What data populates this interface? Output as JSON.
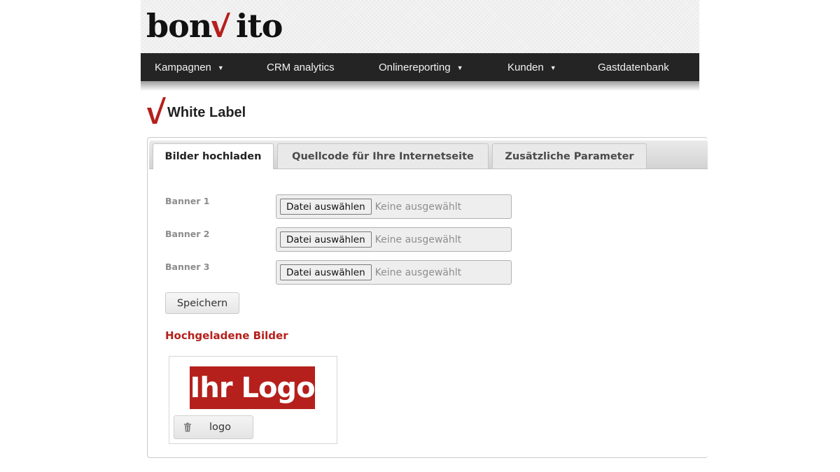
{
  "brand": {
    "logo_prefix": "bon",
    "logo_v": "V",
    "logo_suffix": "ito",
    "accent_color": "#b5201c"
  },
  "nav": {
    "items": [
      {
        "label": "Kampagnen",
        "has_dropdown": true
      },
      {
        "label": "CRM analytics",
        "has_dropdown": false
      },
      {
        "label": "Onlinereporting",
        "has_dropdown": true
      },
      {
        "label": "Kunden",
        "has_dropdown": true
      },
      {
        "label": "Gastdatenbank",
        "has_dropdown": false
      }
    ],
    "caret": "▼"
  },
  "page": {
    "title": "White Label",
    "title_icon": "checkmark-icon"
  },
  "tabs": [
    {
      "label": "Bilder hochladen",
      "active": true
    },
    {
      "label": "Quellcode für Ihre Internetseite",
      "active": false
    },
    {
      "label": "Zusätzliche Parameter",
      "active": false
    }
  ],
  "upload_form": {
    "fields": [
      {
        "label": "Banner 1",
        "button": "Datei auswählen",
        "status": "Keine ausgewählt"
      },
      {
        "label": "Banner 2",
        "button": "Datei auswählen",
        "status": "Keine ausgewählt"
      },
      {
        "label": "Banner 3",
        "button": "Datei auswählen",
        "status": "Keine ausgewählt"
      }
    ],
    "save_label": "Speichern"
  },
  "uploaded": {
    "title": "Hochgeladene Bilder",
    "images": [
      {
        "image_text": "Ihr Logo",
        "delete_icon": "trash-icon",
        "delete_label": "logo"
      }
    ]
  }
}
